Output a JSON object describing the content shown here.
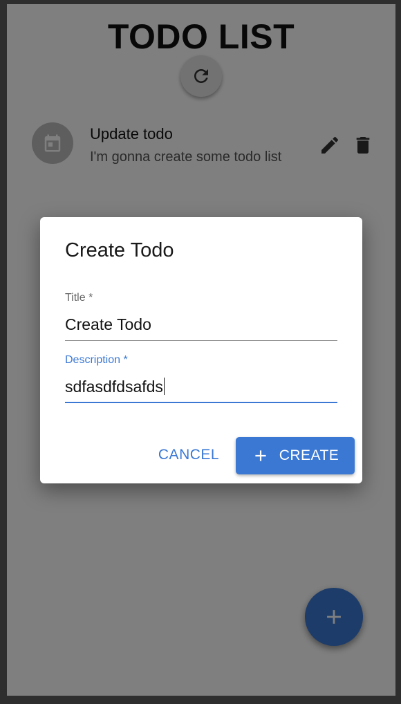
{
  "app": {
    "title": "TODO LIST"
  },
  "todos": [
    {
      "title": "Update todo",
      "description": "I'm gonna create some todo list"
    }
  ],
  "dialog": {
    "title": "Create Todo",
    "fields": [
      {
        "label": "Title",
        "required_mark": "*",
        "value": "Create Todo",
        "focused": false
      },
      {
        "label": "Description",
        "required_mark": "*",
        "value": "sdfasdfdsafds",
        "focused": true
      }
    ],
    "cancel_label": "CANCEL",
    "create_label": "CREATE"
  },
  "colors": {
    "primary": "#3a78d4",
    "overlay": "rgba(0,0,0,0.5)"
  },
  "icons": {
    "refresh": "refresh-icon",
    "todo_avatar": "calendar-icon",
    "edit": "pencil-icon",
    "delete": "trash-icon",
    "create": "plus-icon",
    "fab": "plus-icon"
  }
}
